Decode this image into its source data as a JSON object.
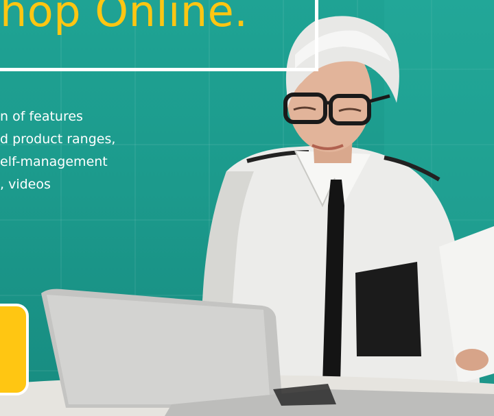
{
  "hero": {
    "title": "hop Online.",
    "feature_lines": [
      "n of features",
      "d product ranges,",
      "elf-management",
      ", videos"
    ]
  },
  "colors": {
    "background_teal": "#1c9a8c",
    "accent_yellow": "#ffc612",
    "border_white": "#ffffff"
  }
}
